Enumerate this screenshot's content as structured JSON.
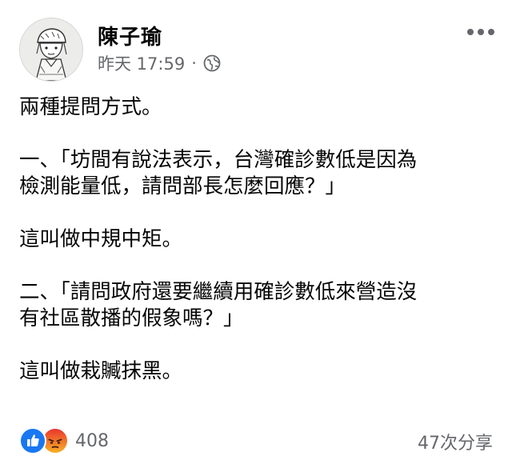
{
  "post": {
    "author": {
      "name": "陳子瑜",
      "avatar_icon": "cartoon-avatar-icon"
    },
    "meta": {
      "time": "昨天 17:59",
      "separator": "·",
      "audience_icon": "globe-icon"
    },
    "more_icon": "more-options-icon",
    "lines": [
      "兩種提問方式。",
      "",
      "一、「坊間有說法表示，台灣確診數低是因為",
      "檢測能量低，請問部長怎麼回應？」",
      "",
      "這叫做中規中矩。",
      "",
      "二、「請問政府還要繼續用確診數低來營造沒",
      "有社區散播的假象嗎？」",
      "",
      "這叫做栽贓抹黑。"
    ],
    "reactions": {
      "icons": [
        "like-icon",
        "angry-icon"
      ],
      "count": "408"
    },
    "shares": "47次分享",
    "colors": {
      "text": "#050505",
      "secondary": "#65676b",
      "like_blue": "#1877f2",
      "angry_orange": "#f0663a"
    }
  }
}
